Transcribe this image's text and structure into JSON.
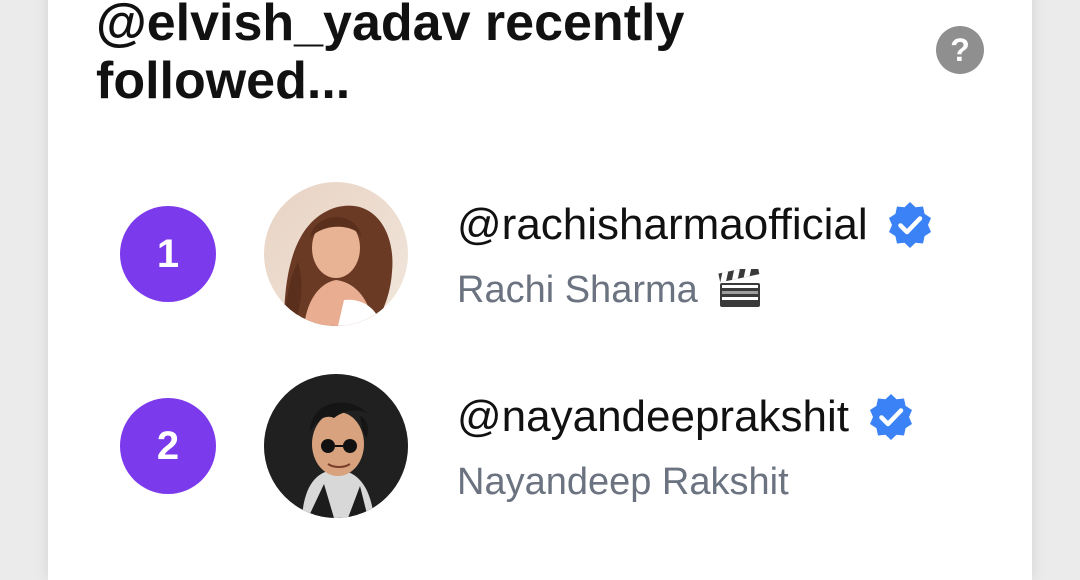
{
  "header": {
    "title": "@elvish_yadav recently followed...",
    "help_icon": "question-mark-icon"
  },
  "colors": {
    "rank_badge": "#7c3aed",
    "verified_badge": "#3b82f6",
    "secondary_text": "#6b7280"
  },
  "follows": [
    {
      "rank": "1",
      "handle": "@rachisharmaofficial",
      "name": "Rachi Sharma",
      "verified": true,
      "name_emoji": "clapper-board-icon"
    },
    {
      "rank": "2",
      "handle": "@nayandeeprakshit",
      "name": "Nayandeep Rakshit",
      "verified": true
    }
  ]
}
